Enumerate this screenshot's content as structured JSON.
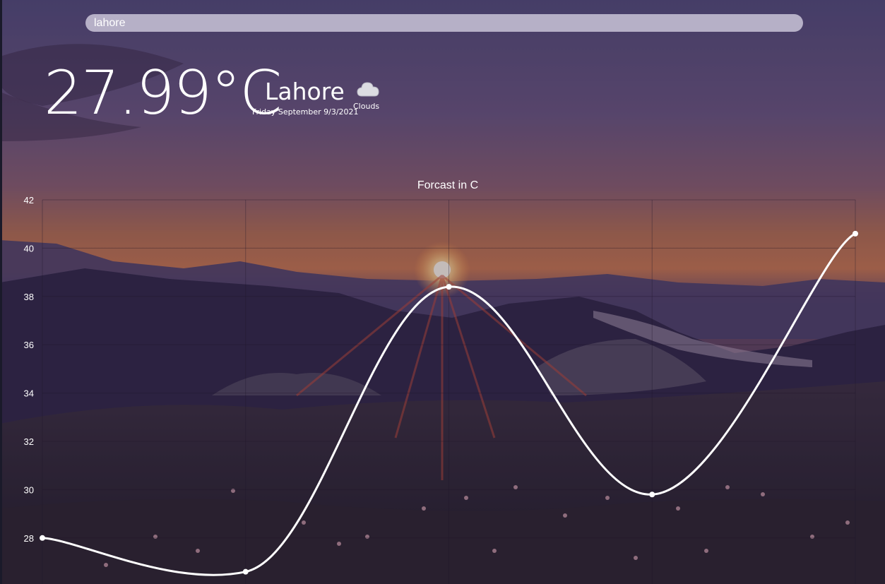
{
  "search": {
    "value": "lahore"
  },
  "weather": {
    "temperature": "27.99°C",
    "city": "Lahore",
    "date": "Friday September 9/3/2021",
    "condition": "Clouds",
    "icon": "cloud-icon"
  },
  "chart_data": {
    "type": "line",
    "title": "Forcast in C",
    "xlabel": "",
    "ylabel": "",
    "x": [
      0,
      1,
      2,
      3,
      4
    ],
    "series": [
      {
        "values": [
          28.0,
          26.6,
          38.4,
          29.8,
          40.6
        ]
      }
    ],
    "ylim": [
      26,
      42
    ],
    "yticks": [
      28,
      30,
      32,
      34,
      36,
      38,
      40,
      42
    ],
    "grid": true,
    "legend": "none",
    "line_color": "#ffffff"
  }
}
